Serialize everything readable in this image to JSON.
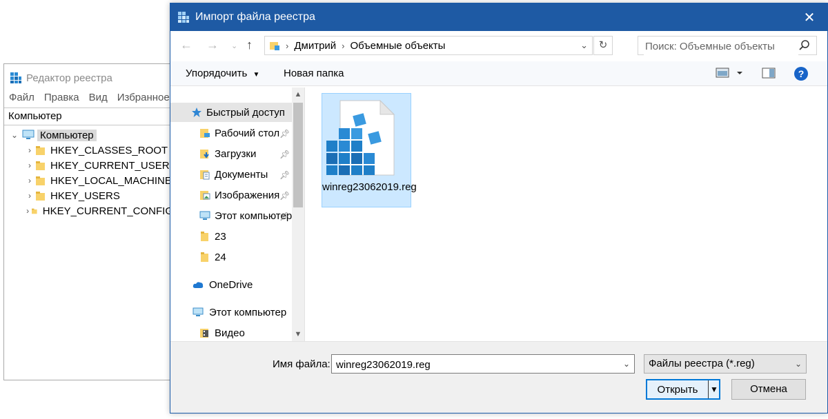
{
  "regedit": {
    "title": "Редактор реестра",
    "menu": [
      "Файл",
      "Правка",
      "Вид",
      "Избранное"
    ],
    "address": "Компьютер",
    "tree_root": "Компьютер",
    "tree_items": [
      "HKEY_CLASSES_ROOT",
      "HKEY_CURRENT_USER",
      "HKEY_LOCAL_MACHINE",
      "HKEY_USERS",
      "HKEY_CURRENT_CONFIG"
    ]
  },
  "dialog": {
    "title": "Импорт файла реестра",
    "breadcrumb": [
      "Дмитрий",
      "Объемные объекты"
    ],
    "search_placeholder": "Поиск: Объемные объекты",
    "toolbar": {
      "organize": "Упорядочить",
      "new_folder": "Новая папка"
    },
    "nav": {
      "quick_access": "Быстрый доступ",
      "items": [
        {
          "label": "Рабочий стол",
          "icon": "desktop-folder-icon",
          "pinned": true
        },
        {
          "label": "Загрузки",
          "icon": "downloads-folder-icon",
          "pinned": true
        },
        {
          "label": "Документы",
          "icon": "documents-folder-icon",
          "pinned": true
        },
        {
          "label": "Изображения",
          "icon": "pictures-folder-icon",
          "pinned": true
        },
        {
          "label": "Этот компьютер",
          "icon": "computer-icon",
          "pinned": true
        },
        {
          "label": "23",
          "icon": "folder-icon",
          "pinned": false
        },
        {
          "label": "24",
          "icon": "folder-icon",
          "pinned": false
        }
      ],
      "onedrive": "OneDrive",
      "this_pc": "Этот компьютер",
      "video": "Видео"
    },
    "files": [
      {
        "name": "winreg23062019.reg",
        "icon": "reg-file-icon",
        "selected": true
      }
    ],
    "filename_label": "Имя файла:",
    "filename_value": "winreg23062019.reg",
    "filetype": "Файлы реестра (*.reg)",
    "open_label": "Открыть",
    "cancel_label": "Отмена"
  },
  "colors": {
    "titlebar": "#1e5aa4",
    "selection": "#cce8ff",
    "accent": "#0078d7"
  }
}
